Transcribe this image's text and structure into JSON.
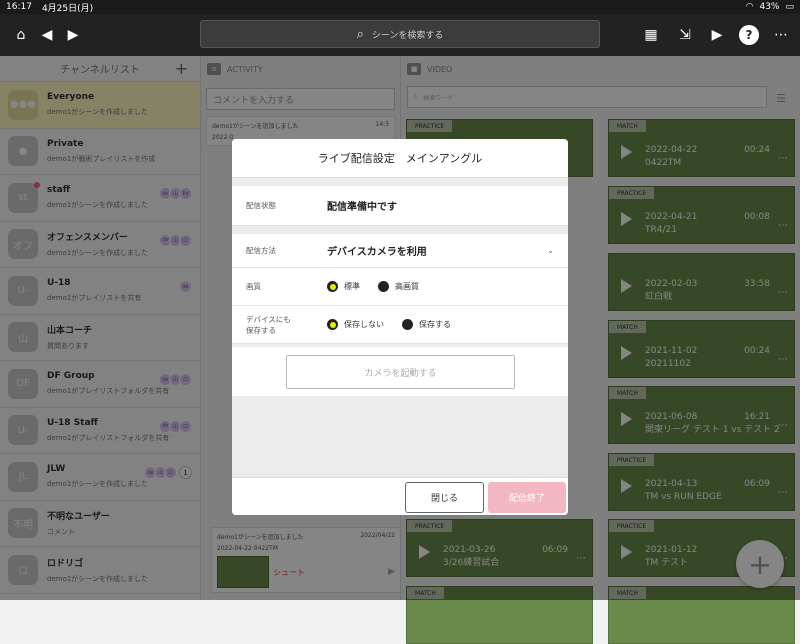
{
  "statusbar": {
    "time": "16:17",
    "date": "4月25日(月)",
    "battery": "43%"
  },
  "topbar": {
    "search_placeholder": "シーンを検索する"
  },
  "channels": {
    "title": "チャンネルリスト",
    "items": [
      {
        "name": "Everyone",
        "sub": "demo1がシーンを作成しました",
        "avatar": ""
      },
      {
        "name": "Private",
        "sub": "demo1が戦術プレイリストを作成",
        "avatar": ""
      },
      {
        "name": "staff",
        "sub": "demo1がシーンを作成しました",
        "avatar": "st"
      },
      {
        "name": "オフェンスメンバー",
        "sub": "demo1がシーンを作成しました",
        "avatar": "オフ"
      },
      {
        "name": "U-18",
        "sub": "demo1がプレイリストを共有",
        "avatar": "U-"
      },
      {
        "name": "山本コーチ",
        "sub": "質問あります",
        "avatar": "山"
      },
      {
        "name": "DF Group",
        "sub": "demo1がプレイリストフォルダを共有",
        "avatar": "DF"
      },
      {
        "name": "U-18 Staff",
        "sub": "demo1がプレイリストフォルダを共有",
        "avatar": "U-"
      },
      {
        "name": "JLW",
        "sub": "demo1がシーンを作成しました",
        "avatar": "JL",
        "count": "1"
      },
      {
        "name": "不明なユーザー",
        "sub": "コメント",
        "avatar": "不明"
      },
      {
        "name": "ロドリゴ",
        "sub": "demo1がシーンを作成しました",
        "avatar": "ロ"
      }
    ]
  },
  "activity": {
    "title": "ACTIVITY",
    "comment_placeholder": "コメントを入力する",
    "first_item": "demo1がシーンを追加しました",
    "first_time": "14:3",
    "first_prefix": "2022-0",
    "last_item": "demo1がシーンを追加しました",
    "last_time": "2022/04/22",
    "last_scene": "2022-04-22 0422TM",
    "shoot": "シュート"
  },
  "video": {
    "title": "VIDEO",
    "search_placeholder": "検索ワード",
    "cards": [
      {
        "tag": "PRACTICE",
        "date": "",
        "title": "",
        "dur": ""
      },
      {
        "tag": "MATCH",
        "date": "2022-04-22",
        "title": "0422TM",
        "dur": "00:24"
      },
      {
        "tag": "PRACTICE",
        "date": "2022-04-21",
        "title": "TR4/21",
        "dur": "00:08"
      },
      {
        "tag": "",
        "date": "2022-02-03",
        "title": "紅白戦",
        "dur": "33:58"
      },
      {
        "tag": "MATCH",
        "date": "2021-11-02",
        "title": "20211102",
        "dur": "00:24"
      },
      {
        "tag": "MATCH",
        "date": "2021-06-08",
        "title": "関東リーグ テスト 1 vs テスト 2",
        "dur": "16:21"
      },
      {
        "tag": "PRACTICE",
        "date": "2021-04-13",
        "title": "TM vs RUN EDGE",
        "dur": "06:09"
      },
      {
        "tag": "PRACTICE",
        "date": "2021-03-26",
        "title": "3/26練習試合",
        "dur": "06:09"
      },
      {
        "tag": "PRACTICE",
        "date": "2021-01-12",
        "title": "TM テスト",
        "dur": ""
      },
      {
        "tag": "MATCH",
        "date": "",
        "title": "",
        "dur": ""
      },
      {
        "tag": "MATCH",
        "date": "",
        "title": "",
        "dur": ""
      }
    ]
  },
  "modal": {
    "title": "ライブ配信設定　メインアングル",
    "status_label": "配信状態",
    "status_value": "配信準備中です",
    "method_label": "配信方法",
    "method_value": "デバイスカメラを利用",
    "quality_label": "画質",
    "quality_opt1": "標準",
    "quality_opt2": "高画質",
    "save_label_1": "デバイスにも",
    "save_label_2": "保存する",
    "save_opt1": "保存しない",
    "save_opt2": "保存する",
    "camera_button": "カメラを起動する",
    "close_button": "閉じる",
    "end_button": "配信終了"
  },
  "colors": {
    "accent_yellow": "#e8f000",
    "end_pink": "#f3b7c3",
    "selected_row": "#fff9c4"
  }
}
